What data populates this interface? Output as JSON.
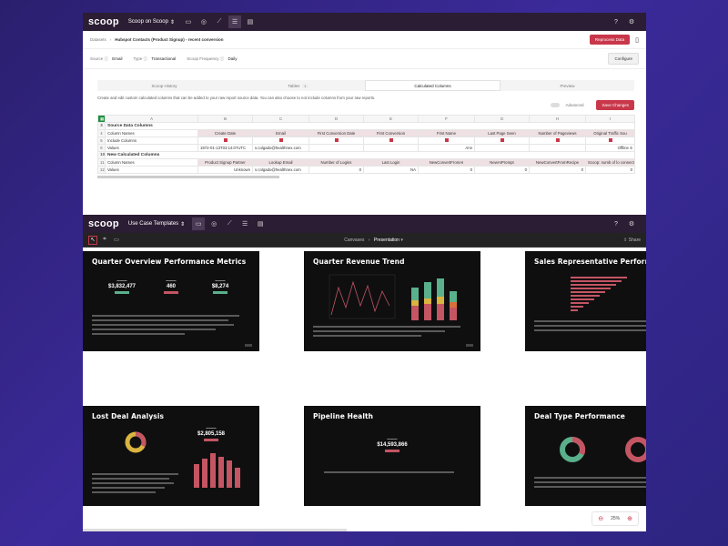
{
  "w1": {
    "topbar": {
      "logo": "scoop",
      "workspace": "Scoop on Scoop"
    },
    "breadcrumb": {
      "root": "Datasets",
      "current": "Hubspot Contacts (Product Signup) - recent conversion"
    },
    "actions": {
      "reprocess": "Reprocess Data"
    },
    "meta": {
      "source_label": "Source",
      "source_value": "Email",
      "type_label": "Type",
      "type_value": "Transactional",
      "freq_label": "Scoop Frequency",
      "freq_value": "Daily",
      "configure": "Configure"
    },
    "tabs": [
      {
        "label": "Scoop History"
      },
      {
        "label": "Tables",
        "badge": "1"
      },
      {
        "label": "Calculated Columns"
      },
      {
        "label": "Preview"
      }
    ],
    "description": "Create and edit custom calculated columns that can be added to your raw report source data. You can also choose to not include columns from your raw reports.",
    "advanced_label": "Advanced",
    "save_label": "Save Changes",
    "sheet": {
      "col_letters": [
        "A",
        "B",
        "C",
        "D",
        "E",
        "F",
        "G",
        "H",
        "I"
      ],
      "source_section": "Source Data Columns",
      "row4_label": "Column Names",
      "source_columns": [
        "Create Date",
        "Email",
        "First Conversion Date",
        "First Conversion",
        "First Name",
        "Last Page Seen",
        "Number of Pageviews",
        "Original Traffic Sou"
      ],
      "row5_label": "Include Columns",
      "row6_label": "Values",
      "row6_values": [
        "1972-01-13T03:14:07UTC",
        "s.colgado@healthnex.com",
        "",
        "",
        "Ann",
        "",
        "",
        "Offline S"
      ],
      "new_section": "New Calculated Columns",
      "row11_label": "Column Names",
      "new_columns": [
        "Product Signup Partner",
        "Lookup Email",
        "Number of Logins",
        "Last Login",
        "NewConvertFromAI",
        "NewAIPrompt",
        "NewConvertFromRecipe",
        "Scoop: numb of lo connected to datas"
      ],
      "row12_label": "Values",
      "row12_values": [
        "Unknown",
        "s.colgado@healthnex.com",
        "0",
        "NA",
        "0",
        "0",
        "0",
        "0"
      ]
    }
  },
  "w2": {
    "topbar": {
      "logo": "scoop",
      "workspace": "Use Case Templates"
    },
    "breadcrumb": {
      "root": "Canvases",
      "current": "Presentation"
    },
    "share": "Share",
    "zoom": "25%",
    "slides": [
      {
        "title": "Quarter Overview Performance Metrics",
        "kpis": [
          "$3,832,477",
          "460",
          "$8,274"
        ]
      },
      {
        "title": "Quarter Revenue Trend"
      },
      {
        "title": "Sales Representative Performance"
      },
      {
        "title": "Lost Deal Analysis",
        "kpis": [
          "$2,805,158"
        ]
      },
      {
        "title": "Pipeline Health",
        "kpis": [
          "$14,593,866"
        ]
      },
      {
        "title": "Deal Type Performance"
      }
    ],
    "colors": {
      "green": "#59b08a",
      "red": "#c45563",
      "yellow": "#d9b43f",
      "orange": "#d8703a"
    }
  }
}
